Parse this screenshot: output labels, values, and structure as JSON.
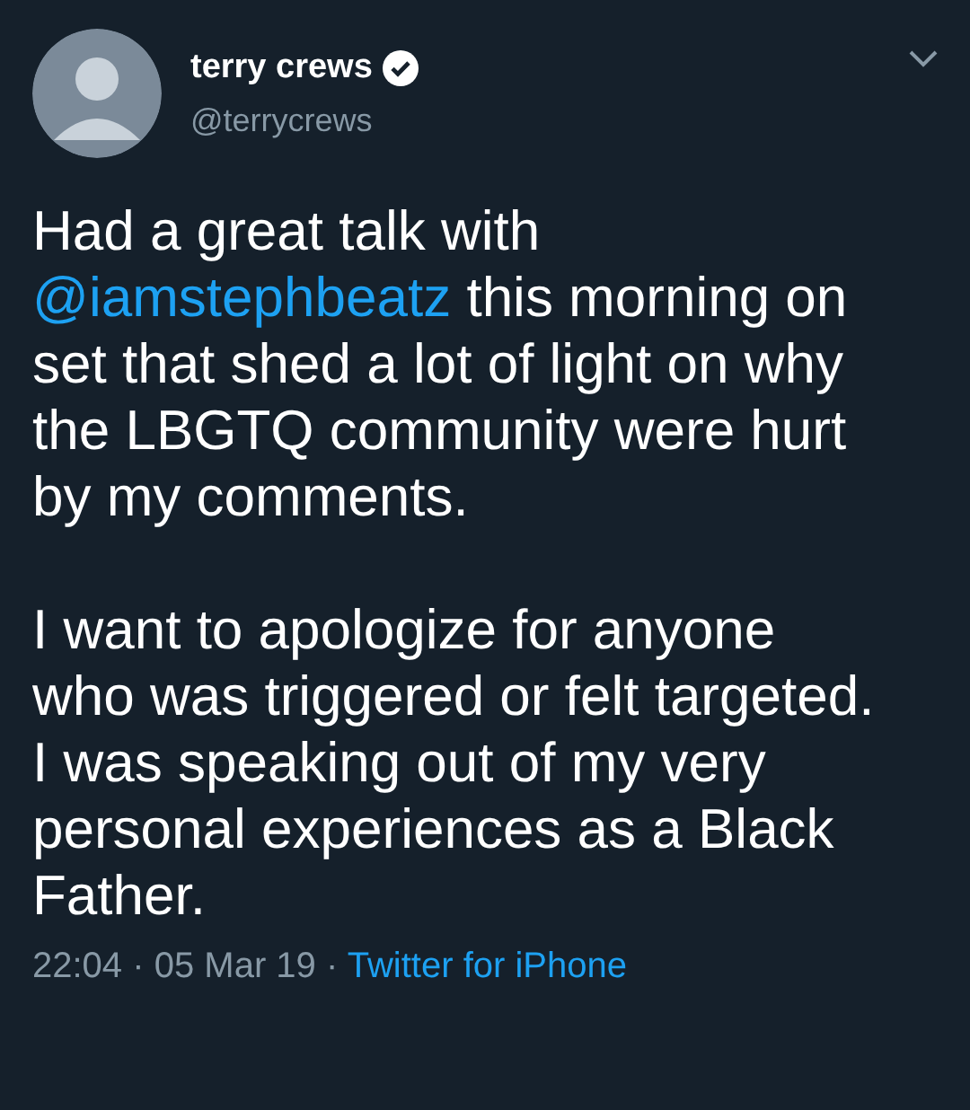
{
  "author": {
    "name": "terry crews",
    "verified": true,
    "handle": "@terrycrews"
  },
  "paragraphs": [
    [
      [
        {
          "kind": "text",
          "text": "Had a great talk with"
        }
      ],
      [
        {
          "kind": "mention",
          "text": "@iamstephbeatz"
        },
        {
          "kind": "text",
          "text": " this morning on"
        }
      ],
      [
        {
          "kind": "text",
          "text": "set that shed a lot of light on why"
        }
      ],
      [
        {
          "kind": "text",
          "text": "the LBGTQ community were hurt"
        }
      ],
      [
        {
          "kind": "text",
          "text": "by my comments."
        }
      ]
    ],
    [
      [
        {
          "kind": "text",
          "text": "I want to apologize for anyone"
        }
      ],
      [
        {
          "kind": "text",
          "text": "who was triggered or felt targeted."
        }
      ],
      [
        {
          "kind": "text",
          "text": "I was speaking out of my very"
        }
      ],
      [
        {
          "kind": "text",
          "text": "personal experiences as a Black"
        }
      ],
      [
        {
          "kind": "text",
          "text": "Father."
        }
      ]
    ]
  ],
  "footer": {
    "time": "22:04",
    "separator": "·",
    "date": "05 Mar 19",
    "source": "Twitter for iPhone"
  }
}
